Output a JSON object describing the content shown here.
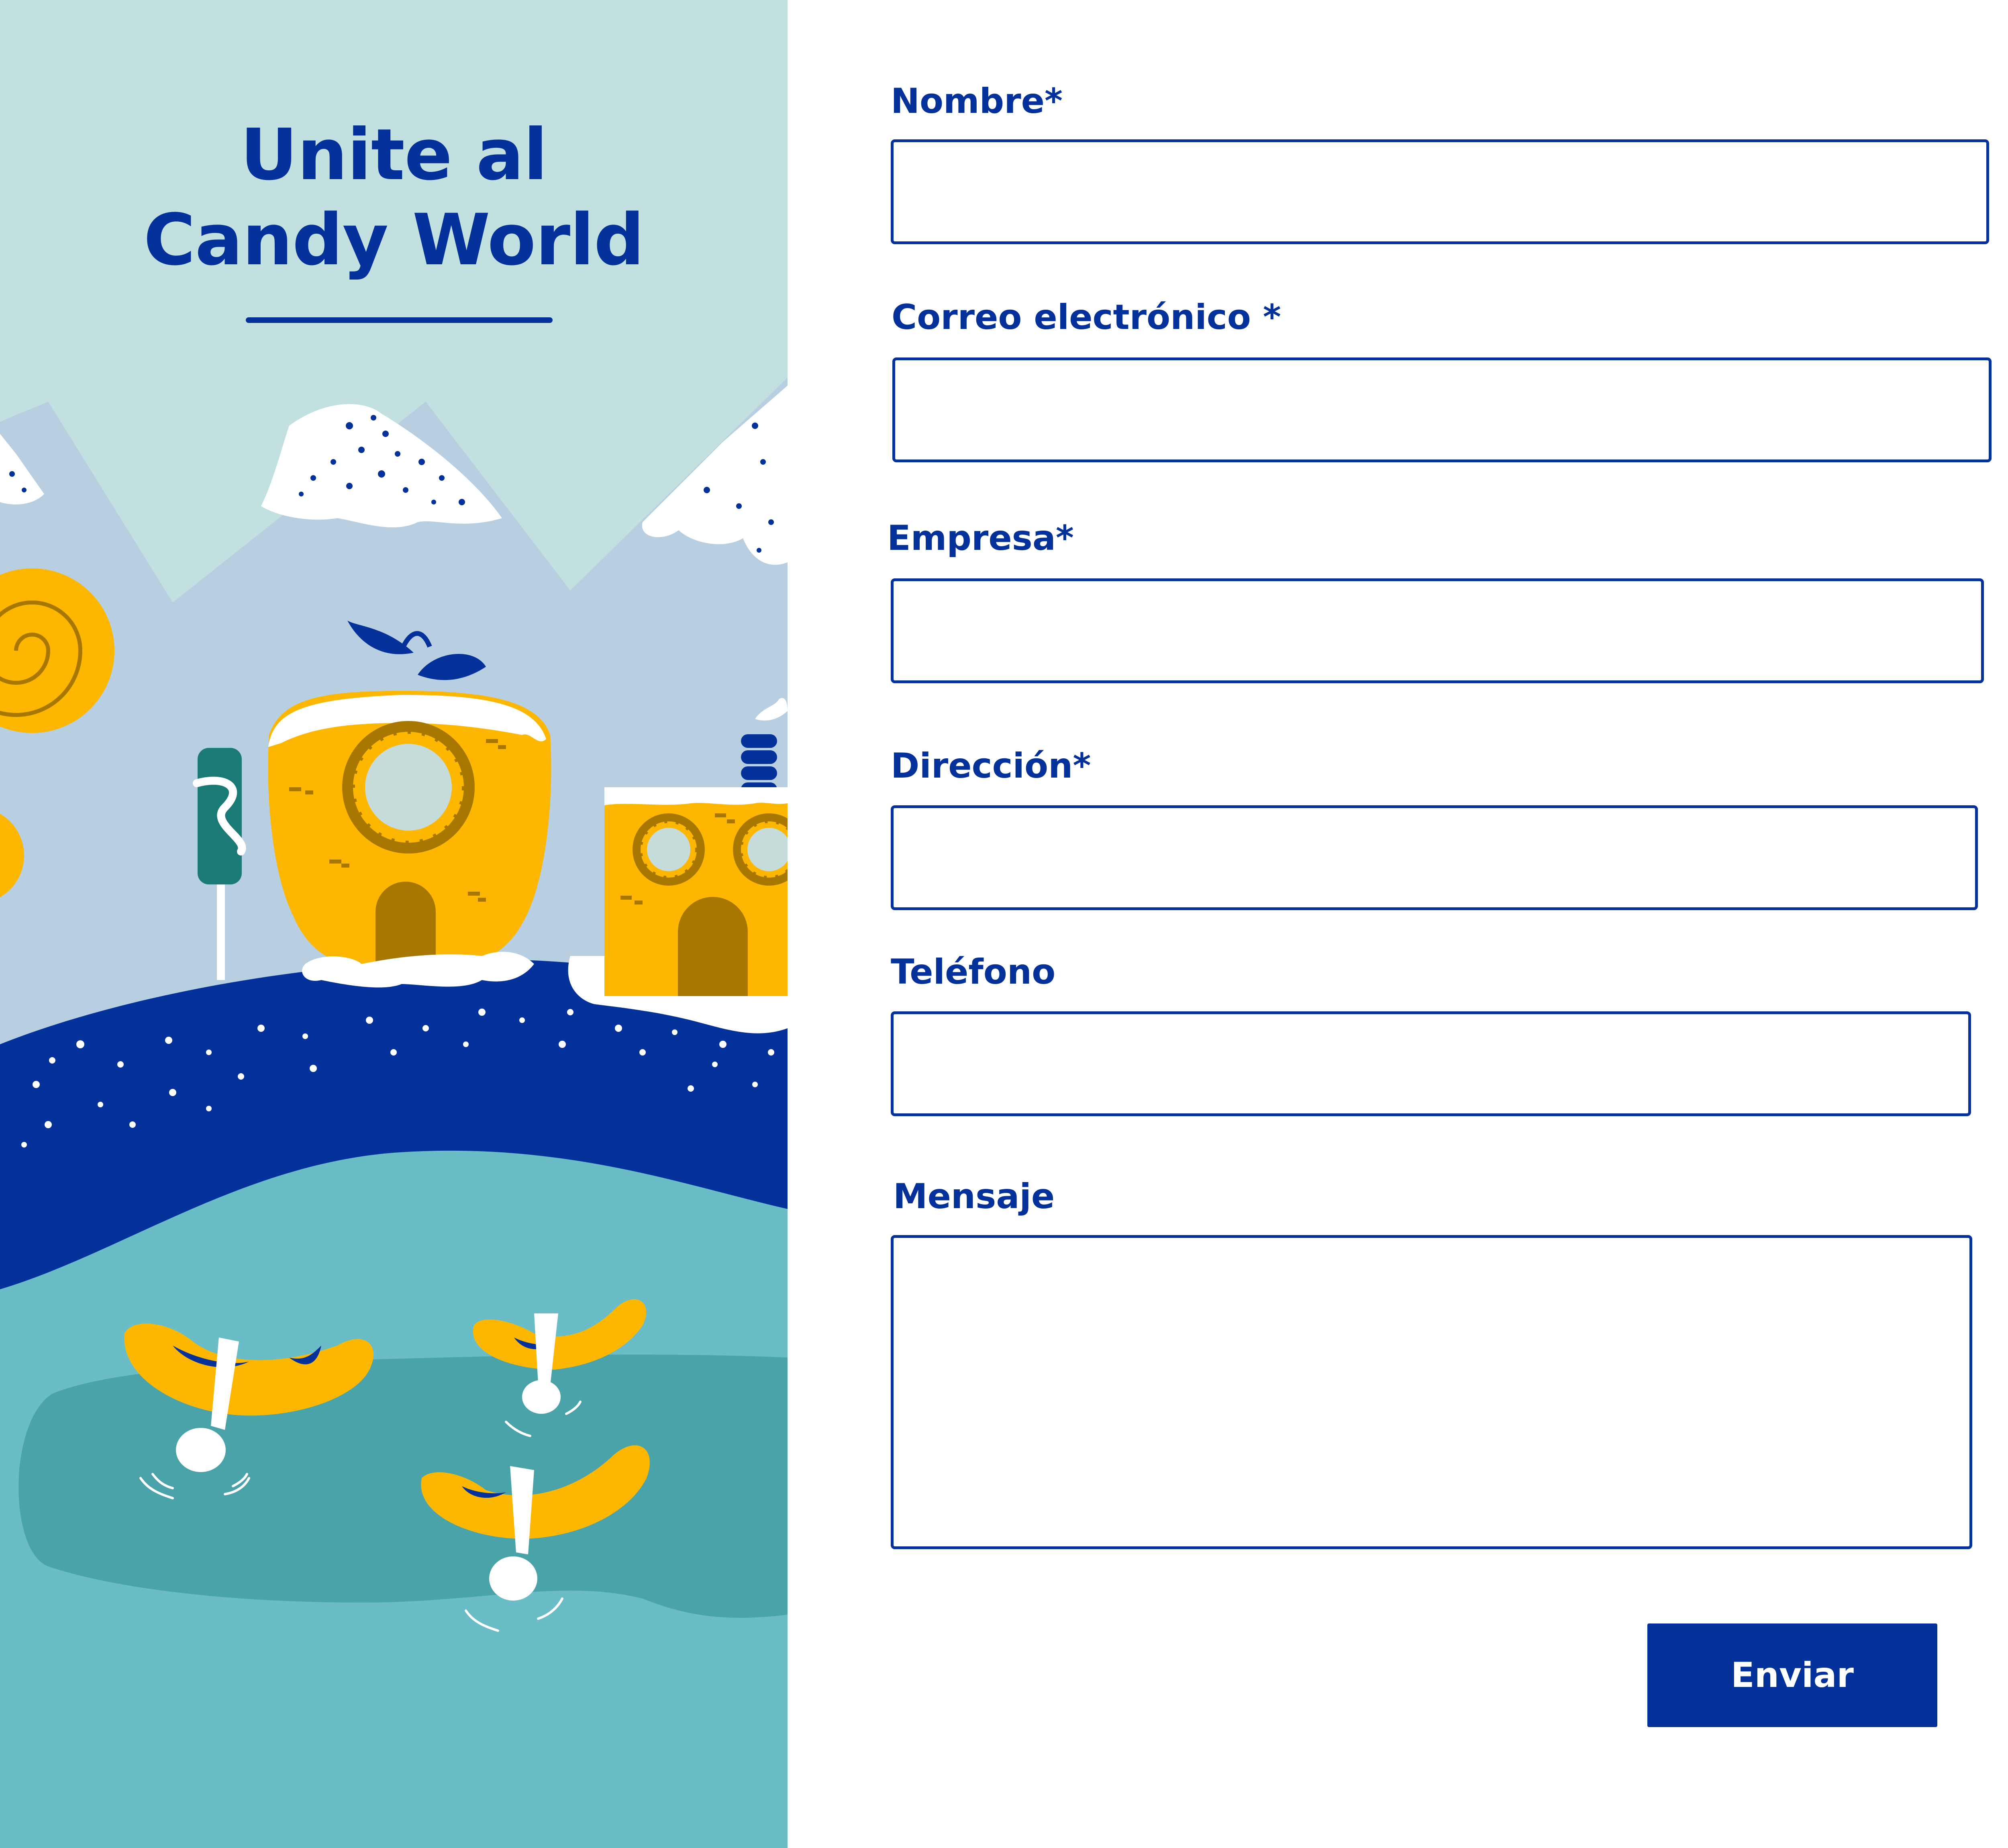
{
  "hero": {
    "title_line1": "Unite al",
    "title_line2": "Candy World"
  },
  "form": {
    "fields": [
      {
        "label": "Nombre*",
        "value": ""
      },
      {
        "label": "Correo electrónico *",
        "value": ""
      },
      {
        "label": "Empresa*",
        "value": ""
      },
      {
        "label": "Dirección*",
        "value": ""
      },
      {
        "label": "Teléfono",
        "value": ""
      },
      {
        "label": "Mensaje",
        "value": ""
      }
    ],
    "submit_label": "Enviar"
  },
  "colors": {
    "brand_blue": "#04319a",
    "sky": "#c2e0df",
    "mountain": "#b7cfe0",
    "candy_yellow": "#fdb701",
    "lake": "#4ba3aa",
    "water": "#6abcc7"
  }
}
